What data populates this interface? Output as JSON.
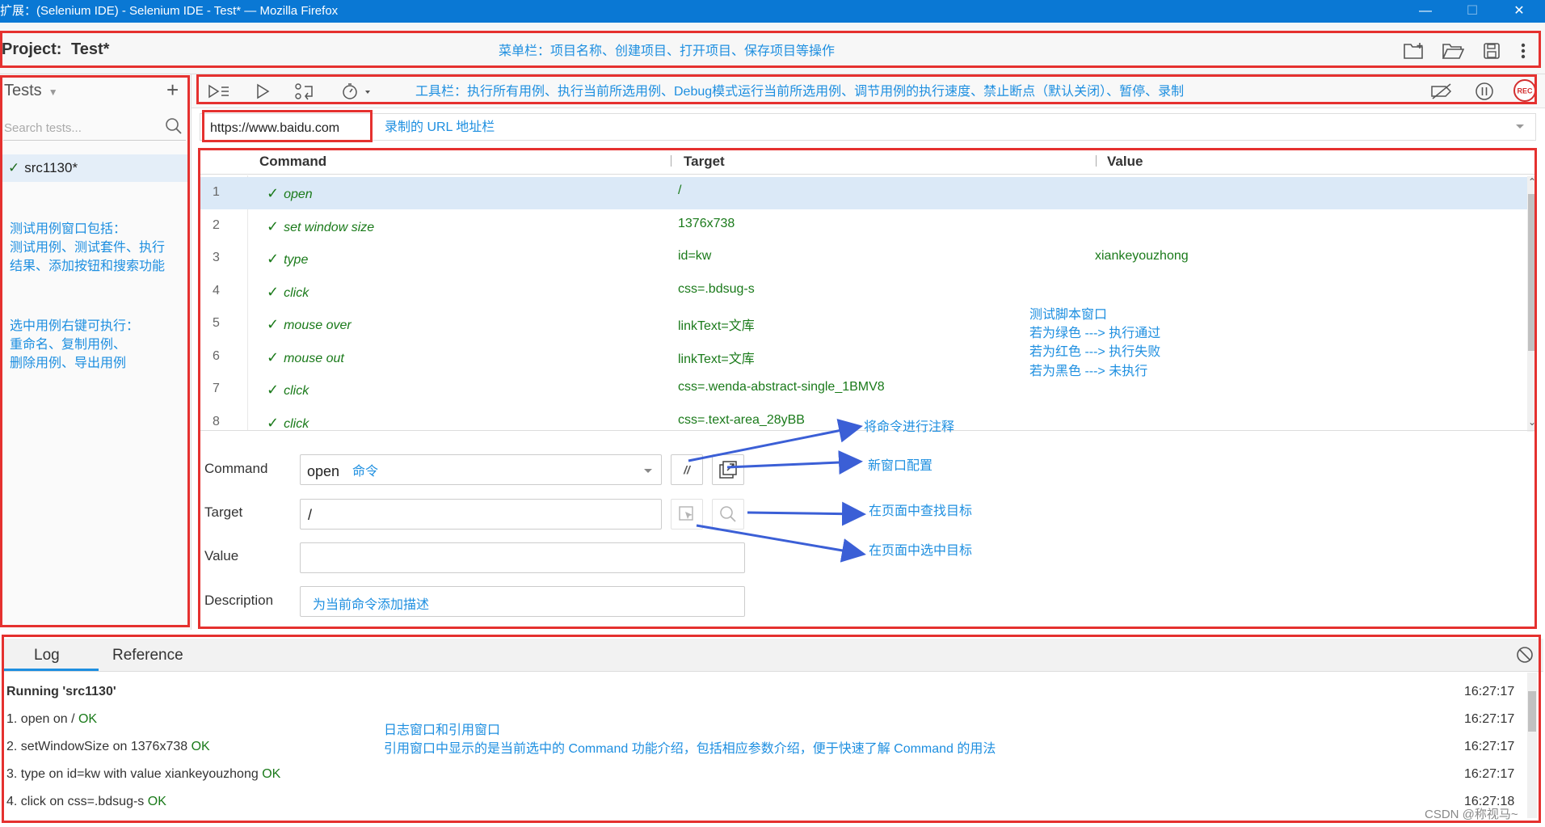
{
  "window": {
    "title": "扩展：(Selenium IDE) - Selenium IDE - Test* — Mozilla Firefox",
    "minimize": "—",
    "maximize": "☐",
    "close": "✕"
  },
  "header": {
    "project_label": "Project:",
    "project_name": "Test*",
    "icons": [
      "new-project-icon",
      "open-project-icon",
      "save-project-icon",
      "more-options-icon"
    ]
  },
  "sidebar": {
    "tests_label": "Tests",
    "search_placeholder": "Search tests...",
    "tests": [
      {
        "name": "src1130*",
        "status": "passed",
        "selected": true
      }
    ]
  },
  "toolbar": {
    "icons": [
      "run-all-tests-icon",
      "run-current-test-icon",
      "step-over-icon",
      "speed-icon",
      "disable-breakpoints-icon",
      "pause-icon",
      "record-icon"
    ],
    "rec_label": "REC"
  },
  "url_bar": {
    "value": "https://www.baidu.com"
  },
  "grid": {
    "columns": [
      "Command",
      "Target",
      "Value"
    ],
    "rows": [
      {
        "num": "1",
        "command": "open",
        "target": "/",
        "value": "",
        "selected": true
      },
      {
        "num": "2",
        "command": "set window size",
        "target": "1376x738",
        "value": ""
      },
      {
        "num": "3",
        "command": "type",
        "target": "id=kw",
        "value": "xiankeyouzhong"
      },
      {
        "num": "4",
        "command": "click",
        "target": "css=.bdsug-s",
        "value": ""
      },
      {
        "num": "5",
        "command": "mouse over",
        "target": "linkText=文库",
        "value": ""
      },
      {
        "num": "6",
        "command": "mouse out",
        "target": "linkText=文库",
        "value": ""
      },
      {
        "num": "7",
        "command": "click",
        "target": "css=.wenda-abstract-single_1BMV8",
        "value": ""
      },
      {
        "num": "8",
        "command": "click",
        "target": "css=.text-area_28yBB",
        "value": ""
      }
    ]
  },
  "editor": {
    "command_label": "Command",
    "command_value": "open",
    "target_label": "Target",
    "target_value": "/",
    "value_label": "Value",
    "value_value": "",
    "description_label": "Description",
    "comment_btn": "//"
  },
  "log": {
    "tabs": [
      "Log",
      "Reference"
    ],
    "active_tab": "Log",
    "lines": [
      {
        "text": "Running 'src1130'",
        "ok": "",
        "time": "16:27:17",
        "bold": true
      },
      {
        "text": "1.   open on / ",
        "ok": "OK",
        "time": "16:27:17"
      },
      {
        "text": "2.   setWindowSize on 1376x738 ",
        "ok": "OK",
        "time": "16:27:17"
      },
      {
        "text": "3.   type on id=kw with value xiankeyouzhong ",
        "ok": "OK",
        "time": "16:27:17"
      },
      {
        "text": "4.   click on css=.bdsug-s ",
        "ok": "OK",
        "time": "16:27:18"
      }
    ]
  },
  "annotations": {
    "menubar": "菜单栏：项目名称、创建项目、打开项目、保存项目等操作",
    "toolbar": "工具栏：执行所有用例、执行当前所选用例、Debug模式运行当前所选用例、调节用例的执行速度、禁止断点（默认关闭）、暂停、录制",
    "url": "录制的 URL 地址栏",
    "sidebar1": [
      "测试用例窗口包括：",
      "测试用例、测试套件、执行",
      "结果、添加按钮和搜索功能"
    ],
    "sidebar2": [
      "选中用例右键可执行：",
      "重命名、复制用例、",
      "删除用例、导出用例"
    ],
    "script_window": [
      "测试脚本窗口",
      "若为绿色 ---> 执行通过",
      "若为红色 ---> 执行失败",
      "若为黑色 ---> 未执行"
    ],
    "comment": "将命令进行注释",
    "new_window": "新窗口配置",
    "find_target": "在页面中查找目标",
    "select_target": "在页面中选中目标",
    "command_hint": "命令",
    "description_hint": "为当前命令添加描述",
    "log_window": [
      "日志窗口和引用窗口",
      "引用窗口中显示的是当前选中的 Command 功能介绍，包括相应参数介绍，便于快速了解 Command 的用法"
    ],
    "watermark": "CSDN @称视马~"
  },
  "colors": {
    "titlebar": "#0a78d4",
    "annotation_box": "#e5312f",
    "annotation_text": "#1e8fe0",
    "pass_green": "#1a7a1a",
    "arrow": "#3b5fd6",
    "rec_red": "#d32f2f"
  }
}
